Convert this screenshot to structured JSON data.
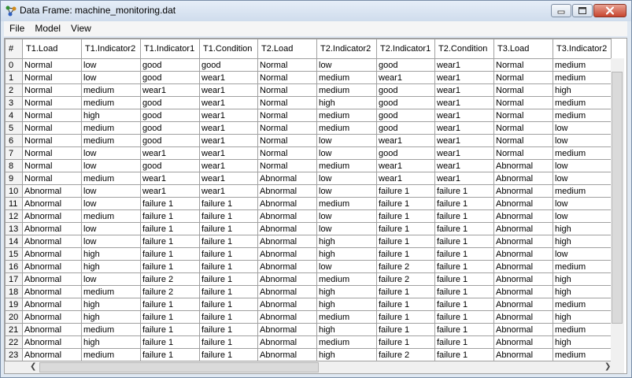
{
  "window": {
    "title": "Data Frame: machine_monitoring.dat",
    "colors": {
      "titlebar": "#d9e4f1",
      "close": "#c7452e"
    }
  },
  "menu": [
    "File",
    "Model",
    "View"
  ],
  "icons": {
    "app": "network-icon",
    "minimize": "minimize-icon",
    "maximize": "maximize-icon",
    "close": "close-icon",
    "scroll_left": "chevron-left-icon",
    "scroll_right": "chevron-right-icon"
  },
  "table": {
    "columns": [
      "#",
      "T1.Load",
      "T1.Indicator2",
      "T1.Indicator1",
      "T1.Condition",
      "T2.Load",
      "T2.Indicator2",
      "T2.Indicator1",
      "T2.Condition",
      "T3.Load",
      "T3.Indicator2"
    ],
    "rows": [
      [
        "0",
        "Normal",
        "low",
        "good",
        "good",
        "Normal",
        "low",
        "good",
        "wear1",
        "Normal",
        "medium"
      ],
      [
        "1",
        "Normal",
        "low",
        "good",
        "wear1",
        "Normal",
        "medium",
        "wear1",
        "wear1",
        "Normal",
        "medium"
      ],
      [
        "2",
        "Normal",
        "medium",
        "wear1",
        "wear1",
        "Normal",
        "medium",
        "good",
        "wear1",
        "Normal",
        "high"
      ],
      [
        "3",
        "Normal",
        "medium",
        "good",
        "wear1",
        "Normal",
        "high",
        "good",
        "wear1",
        "Normal",
        "medium"
      ],
      [
        "4",
        "Normal",
        "high",
        "good",
        "wear1",
        "Normal",
        "medium",
        "good",
        "wear1",
        "Normal",
        "medium"
      ],
      [
        "5",
        "Normal",
        "medium",
        "good",
        "wear1",
        "Normal",
        "medium",
        "good",
        "wear1",
        "Normal",
        "low"
      ],
      [
        "6",
        "Normal",
        "medium",
        "good",
        "wear1",
        "Normal",
        "low",
        "wear1",
        "wear1",
        "Normal",
        "low"
      ],
      [
        "7",
        "Normal",
        "low",
        "wear1",
        "wear1",
        "Normal",
        "low",
        "good",
        "wear1",
        "Normal",
        "medium"
      ],
      [
        "8",
        "Normal",
        "low",
        "good",
        "wear1",
        "Normal",
        "medium",
        "wear1",
        "wear1",
        "Abnormal",
        "low"
      ],
      [
        "9",
        "Normal",
        "medium",
        "wear1",
        "wear1",
        "Abnormal",
        "low",
        "wear1",
        "wear1",
        "Abnormal",
        "low"
      ],
      [
        "10",
        "Abnormal",
        "low",
        "wear1",
        "wear1",
        "Abnormal",
        "low",
        "failure 1",
        "failure 1",
        "Abnormal",
        "medium"
      ],
      [
        "11",
        "Abnormal",
        "low",
        "failure 1",
        "failure 1",
        "Abnormal",
        "medium",
        "failure 1",
        "failure 1",
        "Abnormal",
        "low"
      ],
      [
        "12",
        "Abnormal",
        "medium",
        "failure 1",
        "failure 1",
        "Abnormal",
        "low",
        "failure 1",
        "failure 1",
        "Abnormal",
        "low"
      ],
      [
        "13",
        "Abnormal",
        "low",
        "failure 1",
        "failure 1",
        "Abnormal",
        "low",
        "failure 1",
        "failure 1",
        "Abnormal",
        "high"
      ],
      [
        "14",
        "Abnormal",
        "low",
        "failure 1",
        "failure 1",
        "Abnormal",
        "high",
        "failure 1",
        "failure 1",
        "Abnormal",
        "high"
      ],
      [
        "15",
        "Abnormal",
        "high",
        "failure 1",
        "failure 1",
        "Abnormal",
        "high",
        "failure 1",
        "failure 1",
        "Abnormal",
        "low"
      ],
      [
        "16",
        "Abnormal",
        "high",
        "failure 1",
        "failure 1",
        "Abnormal",
        "low",
        "failure 2",
        "failure 1",
        "Abnormal",
        "medium"
      ],
      [
        "17",
        "Abnormal",
        "low",
        "failure 2",
        "failure 1",
        "Abnormal",
        "medium",
        "failure 2",
        "failure 1",
        "Abnormal",
        "high"
      ],
      [
        "18",
        "Abnormal",
        "medium",
        "failure 2",
        "failure 1",
        "Abnormal",
        "high",
        "failure 1",
        "failure 1",
        "Abnormal",
        "high"
      ],
      [
        "19",
        "Abnormal",
        "high",
        "failure 1",
        "failure 1",
        "Abnormal",
        "high",
        "failure 1",
        "failure 1",
        "Abnormal",
        "medium"
      ],
      [
        "20",
        "Abnormal",
        "high",
        "failure 1",
        "failure 1",
        "Abnormal",
        "medium",
        "failure 1",
        "failure 1",
        "Abnormal",
        "high"
      ],
      [
        "21",
        "Abnormal",
        "medium",
        "failure 1",
        "failure 1",
        "Abnormal",
        "high",
        "failure 1",
        "failure 1",
        "Abnormal",
        "medium"
      ],
      [
        "22",
        "Abnormal",
        "high",
        "failure 1",
        "failure 1",
        "Abnormal",
        "medium",
        "failure 1",
        "failure 1",
        "Abnormal",
        "high"
      ],
      [
        "23",
        "Abnormal",
        "medium",
        "failure 1",
        "failure 1",
        "Abnormal",
        "high",
        "failure 2",
        "failure 1",
        "Abnormal",
        "medium"
      ]
    ]
  }
}
